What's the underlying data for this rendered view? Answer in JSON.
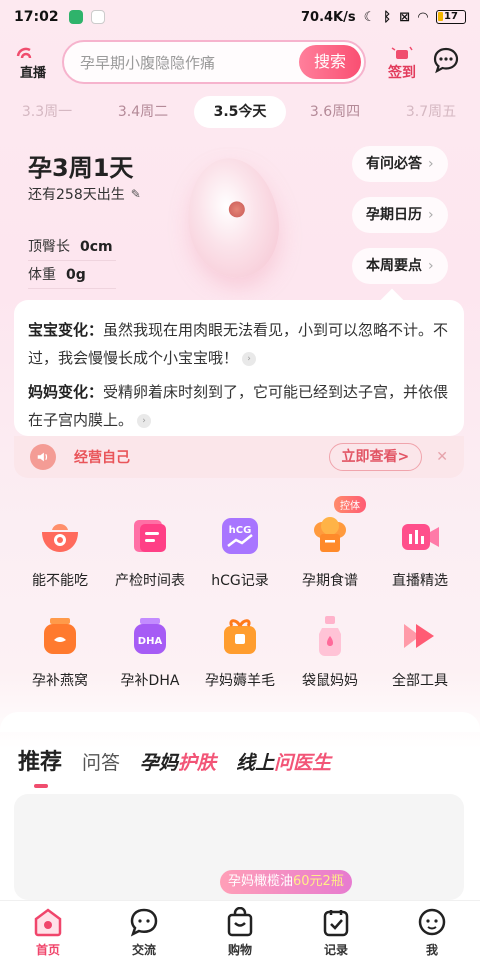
{
  "status_bar": {
    "time": "17:02",
    "speed": "70.4K/s",
    "battery": "17"
  },
  "header": {
    "live_label": "直播",
    "search_placeholder": "孕早期小腹隐隐作痛",
    "search_button": "搜索",
    "signin_label": "签到"
  },
  "dates": [
    {
      "label": "3.3周一",
      "state": "dim"
    },
    {
      "label": "3.4周二",
      "state": "normal"
    },
    {
      "label": "3.5今天",
      "state": "active"
    },
    {
      "label": "3.6周四",
      "state": "normal"
    },
    {
      "label": "3.7周五",
      "state": "dim"
    }
  ],
  "pregnancy": {
    "title": "孕3周1天",
    "days_left": "还有258天出生",
    "crown_rump_label": "顶臀长",
    "crown_rump_value": "0cm",
    "weight_label": "体重",
    "weight_value": "0g"
  },
  "quick_links": [
    "有问必答",
    "孕期日历",
    "本周要点"
  ],
  "changes": {
    "baby_key": "宝宝变化：",
    "baby_text": "虽然我现在用肉眼无法看见，小到可以忽略不计。不过，我会慢慢长成个小宝宝哦！",
    "mom_key": "妈妈变化：",
    "mom_text": "受精卵着床时刻到了，它可能已经到达子宫，并依偎在子宫内膜上。"
  },
  "manage_bar": {
    "text": "经营自己",
    "button": "立即查看>"
  },
  "tools": [
    {
      "label": "能不能吃",
      "icon": "bowl-search-icon"
    },
    {
      "label": "产检时间表",
      "icon": "schedule-icon"
    },
    {
      "label": "hCG记录",
      "icon": "hcg-chart-icon"
    },
    {
      "label": "孕期食谱",
      "icon": "chef-hat-icon",
      "badge": "控体"
    },
    {
      "label": "直播精选",
      "icon": "video-camera-icon"
    },
    {
      "label": "孕补燕窝",
      "icon": "bird-nest-jar-icon"
    },
    {
      "label": "孕补DHA",
      "icon": "dha-jar-icon"
    },
    {
      "label": "孕妈薅羊毛",
      "icon": "gift-box-icon"
    },
    {
      "label": "袋鼠妈妈",
      "icon": "lotion-bottle-icon"
    },
    {
      "label": "全部工具",
      "icon": "fast-forward-icon"
    }
  ],
  "feed_tabs": {
    "recommend": "推荐",
    "qa": "问答",
    "skincare_a": "孕妈",
    "skincare_b": "护肤",
    "doctor_a": "线上",
    "doctor_b": "问医生"
  },
  "promo": {
    "text": "孕妈橄榄油",
    "highlight": "60元2瓶"
  },
  "bottom_nav": [
    {
      "label": "首页",
      "icon": "home-icon",
      "active": true
    },
    {
      "label": "交流",
      "icon": "chat-icon",
      "active": false
    },
    {
      "label": "购物",
      "icon": "shopping-bag-icon",
      "active": false
    },
    {
      "label": "记录",
      "icon": "record-icon",
      "active": false
    },
    {
      "label": "我",
      "icon": "profile-icon",
      "active": false
    }
  ],
  "colors": {
    "accent": "#f04d6e",
    "background": "#fde9f0"
  }
}
